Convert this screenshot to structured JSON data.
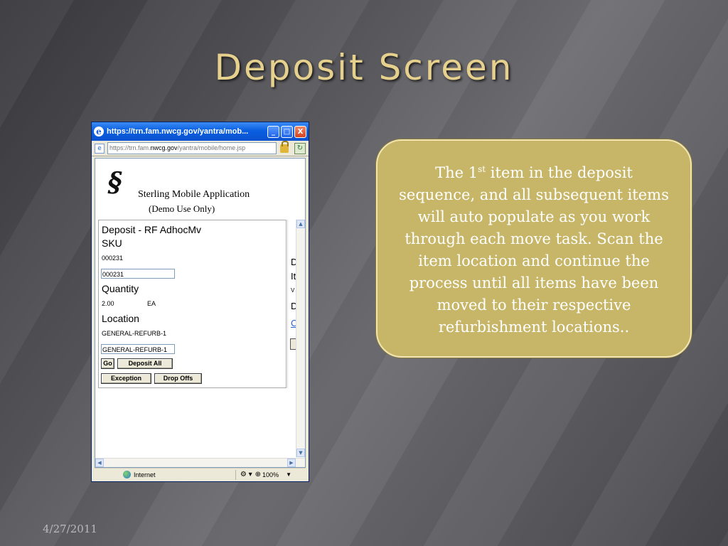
{
  "slide": {
    "title": "Deposit Screen",
    "date": "4/27/2011"
  },
  "browser": {
    "title": "https://trn.fam.nwcg.gov/yantra/mob...",
    "address_prefix": "https://",
    "address_sub": "trn.fam.",
    "address_host": "nwcg.gov",
    "address_path": "/yantra/mobile/home.jsp",
    "status_zone": "Internet",
    "zoom": "100%",
    "window_buttons": {
      "minimize": "_",
      "maximize": "□",
      "close": "X"
    }
  },
  "app": {
    "name": "Sterling Mobile Application",
    "demo": "(Demo Use Only)",
    "form": {
      "header": "Deposit -  RF AdhocMv",
      "sku_label": "SKU",
      "sku_value": "000231",
      "sku_input": "000231",
      "quantity_label": "Quantity",
      "quantity_value": "2.00",
      "quantity_uom": "EA",
      "location_label": "Location",
      "location_value": "GENERAL-REFURB-1",
      "location_input": "GENERAL-REFURB-1",
      "buttons": {
        "go": "Go",
        "deposit_all": "Deposit All",
        "exception": "Exception",
        "drop_offs": "Drop Offs"
      }
    },
    "side_frame": [
      "D",
      "It",
      "V",
      "D",
      "C"
    ]
  },
  "callout": {
    "text_before": "The 1",
    "text_sup": "st",
    "text_after": " item in the deposit sequence, and all subsequent items will auto populate as you work through each move task. Scan the item location and continue the process until all items have been moved to their respective refurbishment locations.."
  },
  "colors": {
    "title": "#e6d08e",
    "callout_fill": "#c7b668",
    "callout_text": "#ffffff"
  }
}
